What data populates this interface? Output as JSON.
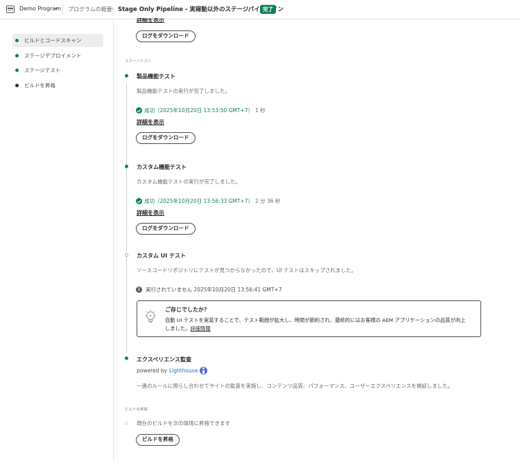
{
  "header": {
    "program_name": "Demo Program",
    "breadcrumb": "プログラムの概要",
    "pipeline_title": "Stage Only Pipeline - 実稼動以外のステージパイプライン",
    "status_badge": "完了"
  },
  "sidebar": {
    "items": [
      {
        "label": "ビルドとコードスキャン",
        "active": true,
        "dot_color": "#12805c"
      },
      {
        "label": "ステージデプロイメント",
        "active": false,
        "dot_color": "#12805c"
      },
      {
        "label": "ステージテスト",
        "active": false,
        "dot_color": "#12805c"
      },
      {
        "label": "ビルドを昇格",
        "active": false,
        "dot_color": "#2c2c2c"
      }
    ]
  },
  "main": {
    "top_partial": {
      "details_link": "詳細を表示",
      "download_button": "ログをダウンロード"
    },
    "stage_test_section": "ステージテスト",
    "steps": [
      {
        "title": "製品機能テスト",
        "description": "製品機能テストの実行が完了しました。",
        "status": "成功（2025年10月20日 13:53:50 GMT+7）",
        "duration": "1 秒",
        "details_link": "詳細を表示",
        "download_button": "ログをダウンロード"
      },
      {
        "title": "カスタム機能テスト",
        "description": "カスタム機能テストの実行が完了しました。",
        "status": "成功（2025年10月20日 13:56:33 GMT+7）",
        "duration": "2 分 36 秒",
        "details_link": "詳細を表示",
        "download_button": "ログをダウンロード"
      },
      {
        "title": "カスタム UI テスト",
        "description": "ソースコードリポジトリにテストが見つからなかったので、UI テストはスキップされました。",
        "info": "実行されていません 2025年10月20日 13:56:41 GMT+7",
        "tip": {
          "title": "ご存じでしたか？",
          "text": "自動 UI テストを実装することで、テスト範囲が拡大し、時間が節約され、最終的にはお客様の AEM アプリケーションの品質が向上しました。",
          "link": "詳細情報"
        }
      },
      {
        "title": "エクスペリエンス監査",
        "powered_by": "powered by",
        "lighthouse": "Lighthouse",
        "description": "一連のルールに照らし合わせてサイトの監査を実施し、コンテンツ品質、パフォーマンス、ユーザーエクスペリエンスを検証しました。"
      }
    ],
    "promote_section": "ビルドを昇格",
    "promote_text": "現在のビルドを次の環境に昇格できます",
    "promote_button": "ビルドを昇格"
  },
  "colors": {
    "success": "#12805c",
    "link_blue": "#1a73c9",
    "border": "#4b4b4b"
  },
  "icons": [
    "program-icon",
    "chevron-down-icon",
    "checkmark-circle-icon",
    "info-icon",
    "lightbulb-icon",
    "lighthouse-icon"
  ]
}
